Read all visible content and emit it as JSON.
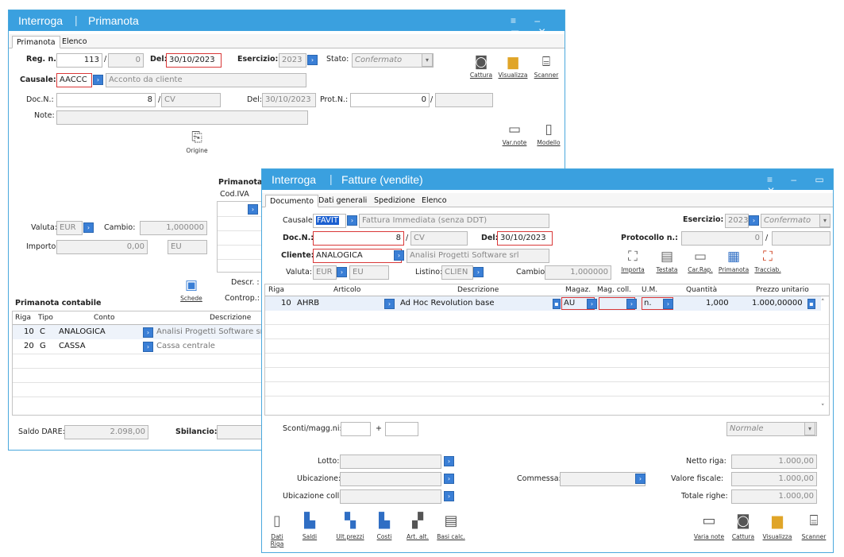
{
  "w1": {
    "title": "Interroga",
    "subtitle": "Primanota",
    "tabs": [
      "Primanota",
      "Elenco"
    ],
    "reg_label": "Reg. n.:",
    "reg_n": "113",
    "reg_sep": "/",
    "reg_alfa": "0",
    "del_label": "Del:",
    "del_date": "30/10/2023",
    "esercizio_label": "Esercizio:",
    "esercizio": "2023",
    "stato_label": "Stato:",
    "stato": "Confermato",
    "causale_label": "Causale:",
    "causale_code": "AACCC",
    "causale_desc": "Acconto da cliente",
    "docn_label": "Doc.N.:",
    "docn": "8",
    "docn_sep": "/",
    "docn_alfa": "CV",
    "del2_label": "Del:",
    "del2_date": "30/10/2023",
    "protn_label": "Prot.N.:",
    "protn": "0",
    "protn_sep": "/",
    "note_label": "Note:",
    "btn_cattura": "Cattura",
    "btn_visualizza": "Visualizza",
    "btn_scanner": "Scanner",
    "btn_origine": "Origine",
    "btn_varnote": "Var.note",
    "btn_modello": "Modello",
    "primanota_label": "Primanota",
    "codiva_label": "Cod.IVA",
    "valuta_label": "Valuta:",
    "valuta": "EUR",
    "cambio_label": "Cambio:",
    "cambio": "1,000000",
    "importo_label": "Importo:",
    "importo": "0,00",
    "importo_cur": "EU",
    "btn_schede": "Schede",
    "descr_label": "Descr. :",
    "controp_label": "Controp.:",
    "grid_title": "Primanota contabile",
    "grid_headers": [
      "Riga",
      "Tipo",
      "Conto",
      "Descrizione"
    ],
    "rows": [
      {
        "riga": "10",
        "tipo": "C",
        "conto": "ANALOGICA",
        "desc": "Analisi Progetti Software srl"
      },
      {
        "riga": "20",
        "tipo": "G",
        "conto": "CASSA",
        "desc": "Cassa centrale"
      }
    ],
    "saldo_label": "Saldo DARE:",
    "saldo": "2.098,00",
    "sbilancio_label": "Sbilancio:"
  },
  "w2": {
    "title": "Interroga",
    "subtitle": "Fatture (vendite)",
    "tabs": [
      "Documento",
      "Dati generali",
      "Spedizione",
      "Elenco"
    ],
    "causale_label": "Causale:",
    "causale_code": "FAVIT",
    "causale_desc": "Fattura Immediata (senza DDT)",
    "esercizio_label": "Esercizio:",
    "esercizio": "2023",
    "stato": "Confermato",
    "docn_label": "Doc.N.:",
    "docn": "8",
    "docn_sep": "/",
    "docn_alfa": "CV",
    "del_label": "Del:",
    "del_date": "30/10/2023",
    "protocollo_label": "Protocollo n.:",
    "protocollo": "0",
    "protocollo_sep": "/",
    "cliente_label": "Cliente:",
    "cliente_code": "ANALOGICA",
    "cliente_desc": "Analisi Progetti Software srl",
    "valuta_label": "Valuta:",
    "valuta": "EUR",
    "valuta_cur": "EU",
    "listino_label": "Listino:",
    "listino": "CLIEN",
    "cambio_label": "Cambio:",
    "cambio": "1,000000",
    "tb": [
      "Importa",
      "Testata",
      "Car.Rap.",
      "Primanota",
      "Tracciab."
    ],
    "grid_headers": [
      "Riga",
      "Articolo",
      "Descrizione",
      "Magaz.",
      "Mag. coll.",
      "U.M.",
      "Quantità",
      "Prezzo unitario"
    ],
    "row": {
      "riga": "10",
      "articolo": "AHRB",
      "desc": "Ad Hoc Revolution base",
      "magaz": "AU",
      "um": "n.",
      "qta": "1,000",
      "prezzo": "1.000,00000"
    },
    "sconti_label": "Sconti/magg.ni:",
    "sconti_plus": "+",
    "normale": "Normale",
    "lotto_label": "Lotto:",
    "ubicazione_label": "Ubicazione:",
    "ubicazione_coll_label": "Ubicazione coll.:",
    "commessa_label": "Commessa:",
    "netto_riga_label": "Netto riga:",
    "netto_riga": "1.000,00",
    "valore_fiscale_label": "Valore fiscale:",
    "valore_fiscale": "1.000,00",
    "totale_righe_label": "Totale righe:",
    "totale_righe": "1.000,00",
    "bottom_left": [
      "Dati Riga",
      "Saldi",
      "Ult.prezzi",
      "Costi",
      "Art. alt.",
      "Basi calc."
    ],
    "bottom_right": [
      "Varia note",
      "Cattura",
      "Visualizza",
      "Scanner"
    ]
  },
  "colors": {
    "titlebar": "#3aa0df",
    "required_border": "#d93838",
    "zoom_button": "#3a7fd6"
  }
}
